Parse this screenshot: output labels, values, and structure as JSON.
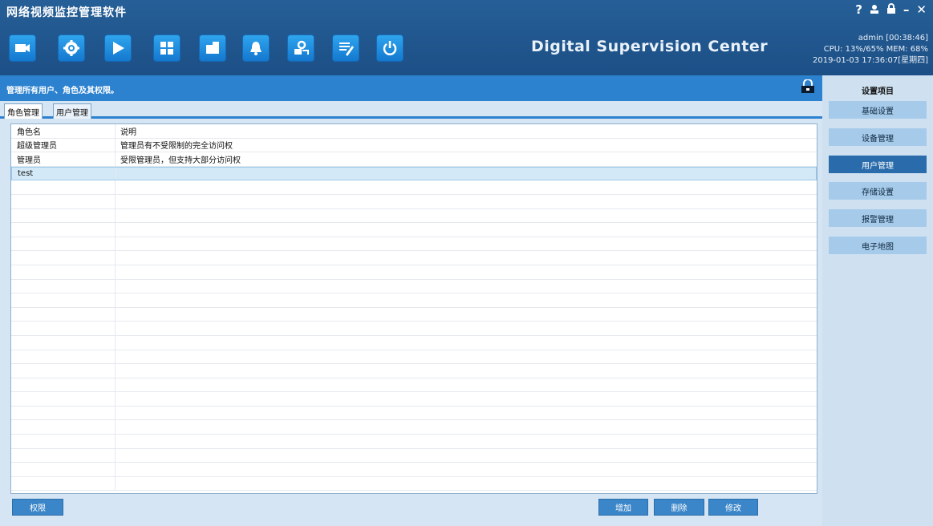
{
  "app": {
    "title": "网络视频监控管理软件",
    "brand": "Digital Supervision Center"
  },
  "window_controls": [
    "?",
    "person",
    "lock",
    "minimize",
    "close"
  ],
  "status": {
    "user_time": "admin  [00:38:46]",
    "usage": "CPU: 13%/65%  MEM: 68%",
    "datetime": "2019-01-03 17:36:07[星期四]"
  },
  "toolbar": [
    {
      "name": "camera-icon"
    },
    {
      "name": "gear-icon"
    },
    {
      "name": "play-icon"
    },
    {
      "name": "layout-icon"
    },
    {
      "name": "storage-icon"
    },
    {
      "name": "alarm-icon"
    },
    {
      "name": "user-key-icon"
    },
    {
      "name": "edit-icon"
    },
    {
      "name": "power-icon"
    }
  ],
  "description": "管理所有用户、角色及其权限。",
  "tabs": [
    {
      "label": "角色管理",
      "active": true
    },
    {
      "label": "用户管理",
      "active": false
    }
  ],
  "grid": {
    "headers": [
      "角色名",
      "说明"
    ],
    "rows": [
      [
        "超级管理员",
        "管理员有不受限制的完全访问权"
      ],
      [
        "管理员",
        "受限管理员，但支持大部分访问权"
      ],
      [
        "test",
        ""
      ]
    ],
    "selected_row": 2
  },
  "buttons": {
    "permission": "权限",
    "add": "增加",
    "delete": "删除",
    "modify": "修改"
  },
  "sidebar": {
    "title": "设置项目",
    "items": [
      {
        "label": "基础设置",
        "active": false
      },
      {
        "label": "设备管理",
        "active": false
      },
      {
        "label": "用户管理",
        "active": true
      },
      {
        "label": "存储设置",
        "active": false
      },
      {
        "label": "报警管理",
        "active": false
      },
      {
        "label": "电子地图",
        "active": false
      }
    ]
  },
  "colors": {
    "header": "#1c4f86",
    "accent": "#2d82cf",
    "sidebar_active": "#2a6cab"
  }
}
